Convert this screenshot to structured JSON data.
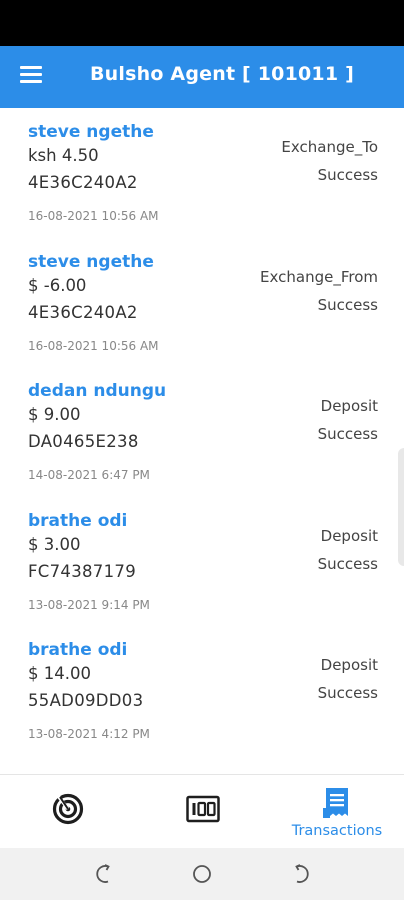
{
  "header": {
    "title": "Bulsho Agent [ 101011 ]"
  },
  "transactions": [
    {
      "name": "steve ngethe",
      "amount": "ksh 4.50",
      "ref": "4E36C240A2",
      "date": "16-08-2021 10:56 AM",
      "type": "Exchange_To",
      "status": "Success"
    },
    {
      "name": "steve ngethe",
      "amount": "$ -6.00",
      "ref": "4E36C240A2",
      "date": "16-08-2021 10:56 AM",
      "type": "Exchange_From",
      "status": "Success"
    },
    {
      "name": "dedan ndungu",
      "amount": "$ 9.00",
      "ref": "DA0465E238",
      "date": "14-08-2021 6:47 PM",
      "type": "Deposit",
      "status": "Success"
    },
    {
      "name": "brathe odi",
      "amount": "$ 3.00",
      "ref": "FC74387179",
      "date": "13-08-2021 9:14 PM",
      "type": "Deposit",
      "status": "Success"
    },
    {
      "name": "brathe odi",
      "amount": "$ 14.00",
      "ref": "55AD09DD03",
      "date": "13-08-2021 4:12 PM",
      "type": "Deposit",
      "status": "Success"
    }
  ],
  "bottom_nav": {
    "items": [
      {
        "icon": "radar-icon",
        "label": ""
      },
      {
        "icon": "counter-icon",
        "label": ""
      },
      {
        "icon": "receipt-icon",
        "label": "Transactions"
      }
    ]
  },
  "colors": {
    "primary": "#2c8de8"
  }
}
